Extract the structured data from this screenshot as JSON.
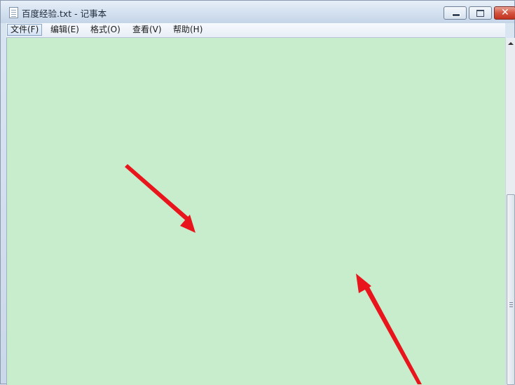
{
  "window": {
    "title": "百度经验.txt - 记事本"
  },
  "menu": {
    "items": [
      "文件(F)",
      "编辑(E)",
      "格式(O)",
      "查看(V)",
      "帮助(H)"
    ],
    "active_index": 0
  },
  "editor": {
    "content": "",
    "background_color": "#c7edcc"
  },
  "colors": {
    "annotation_arrow": "#e8161c",
    "close_button": "#c8402b"
  },
  "icons": {
    "app": "notepad-document-icon",
    "minimize": "minimize-icon",
    "maximize": "maximize-icon",
    "close": "close-icon",
    "scroll_up": "chevron-up-icon"
  }
}
